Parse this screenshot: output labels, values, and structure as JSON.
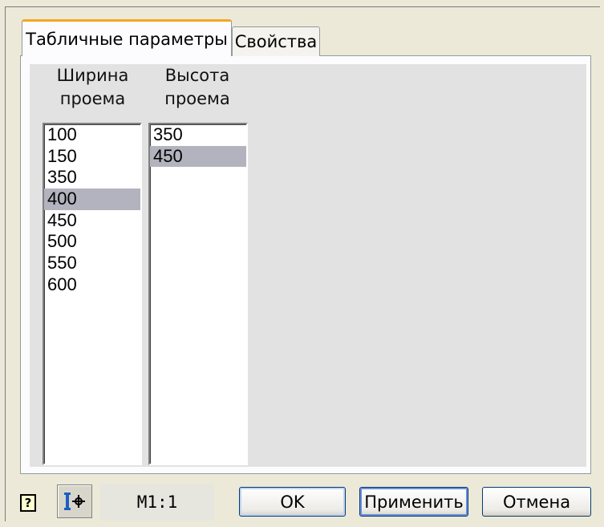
{
  "tabs": [
    {
      "label": "Табличные параметры",
      "active": true
    },
    {
      "label": "Свойства",
      "active": false
    }
  ],
  "table": {
    "width_header_line1": "Ширина",
    "width_header_line2": "проема",
    "height_header_line1": "Высота",
    "height_header_line2": "проема",
    "width_values": [
      "100",
      "150",
      "350",
      "400",
      "450",
      "500",
      "550",
      "600"
    ],
    "width_selected": "400",
    "height_values": [
      "350",
      "450"
    ],
    "height_selected": "450"
  },
  "footer": {
    "help_icon": "help-icon",
    "snap_icon": "snap-point-icon",
    "scale": "M1:1",
    "ok_label": "OK",
    "apply_label": "Применить",
    "cancel_label": "Отмена"
  }
}
